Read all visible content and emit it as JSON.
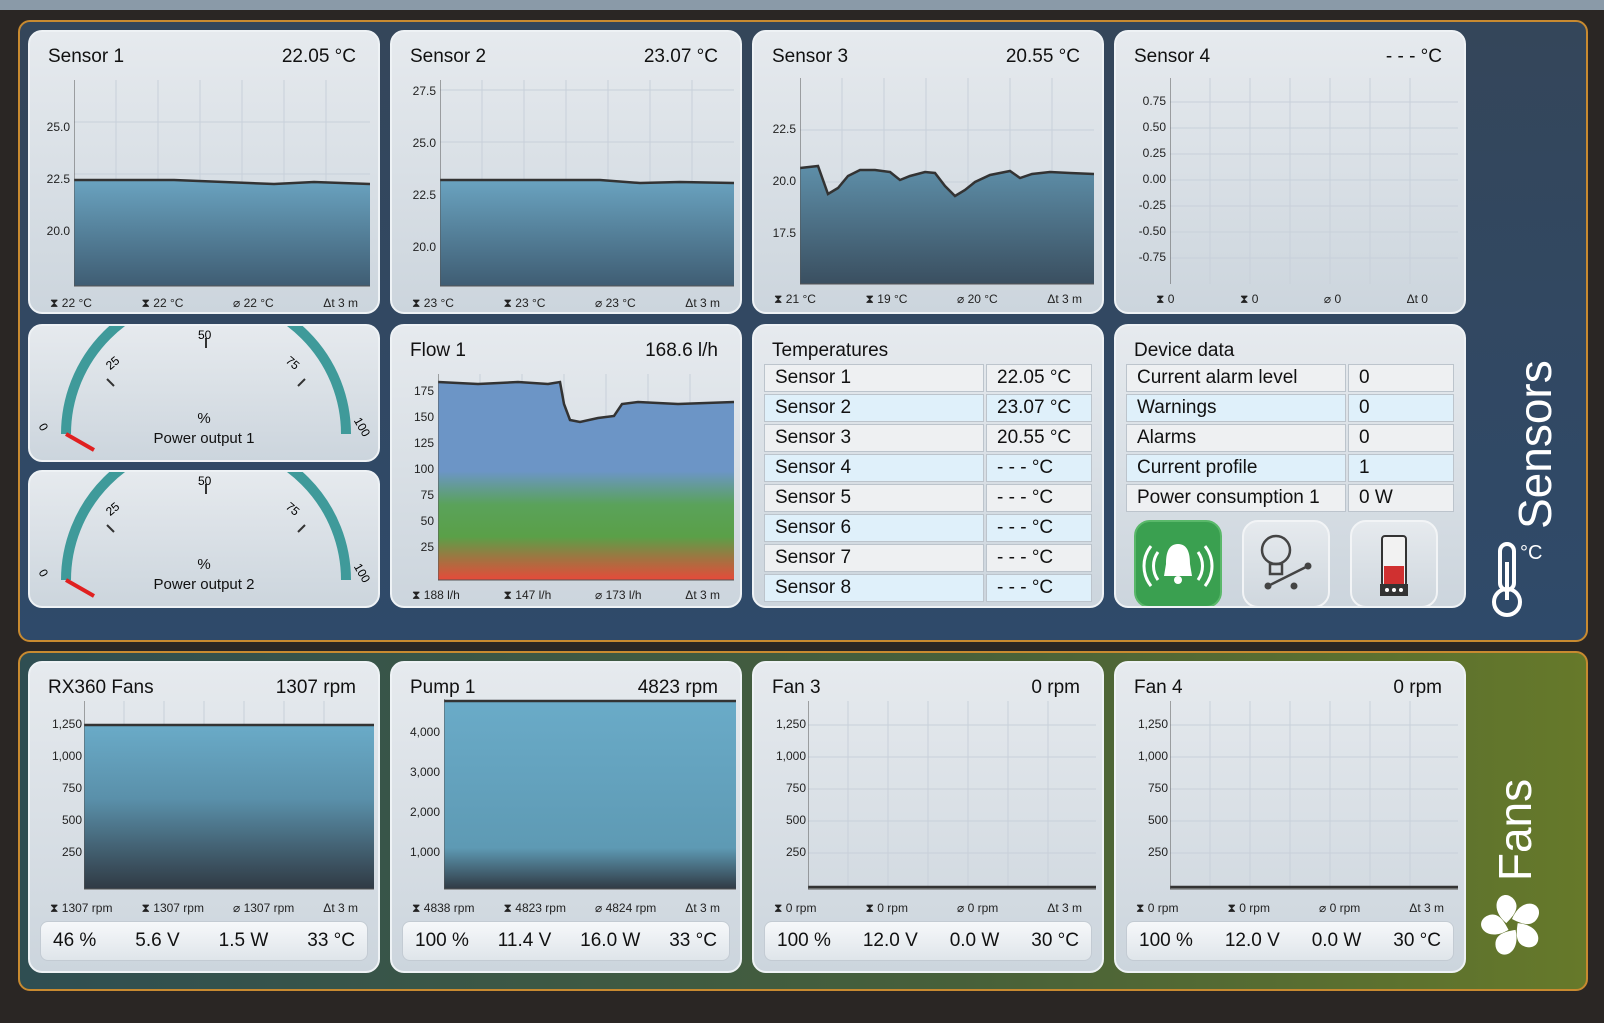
{
  "groups": {
    "sensors_label": "Sensors",
    "fans_label": "Fans"
  },
  "colors": {
    "group_border": "#c88a30",
    "fill_top": "#6aa3c0",
    "fill_bottom": "#3d5a70",
    "gauge_arc": "#3f9a9a",
    "needle": "#e02020",
    "alarm_button": "#3aa050"
  },
  "sensor_charts": [
    {
      "title": "Sensor 1",
      "value": "22.05 °C",
      "ticks": [
        "25.0",
        "22.5",
        "20.0"
      ],
      "stats": [
        "22 °C",
        "22 °C",
        "22 °C",
        "3 m"
      ]
    },
    {
      "title": "Sensor 2",
      "value": "23.07 °C",
      "ticks": [
        "27.5",
        "25.0",
        "22.5",
        "20.0"
      ],
      "stats": [
        "23 °C",
        "23 °C",
        "23 °C",
        "3 m"
      ]
    },
    {
      "title": "Sensor 3",
      "value": "20.55 °C",
      "ticks": [
        "22.5",
        "20.0",
        "17.5"
      ],
      "stats": [
        "21 °C",
        "19 °C",
        "20 °C",
        "3 m"
      ]
    },
    {
      "title": "Sensor 4",
      "value": "- - - °C",
      "ticks": [
        "0.75",
        "0.50",
        "0.25",
        "0.00",
        "-0.25",
        "-0.50",
        "-0.75"
      ],
      "stats": [
        "0",
        "0",
        "0",
        "0"
      ]
    }
  ],
  "gauges": [
    {
      "unit": "%",
      "title": "Power output 1",
      "value": 0,
      "ticks": [
        "0",
        "25",
        "50",
        "75",
        "100"
      ]
    },
    {
      "unit": "%",
      "title": "Power output 2",
      "value": 0,
      "ticks": [
        "0",
        "25",
        "50",
        "75",
        "100"
      ]
    }
  ],
  "flow": {
    "title": "Flow 1",
    "value": "168.6 l/h",
    "ticks": [
      "175",
      "150",
      "125",
      "100",
      "75",
      "50",
      "25"
    ],
    "stats": [
      "188 l/h",
      "147 l/h",
      "173 l/h",
      "3 m"
    ]
  },
  "temperatures": {
    "title": "Temperatures",
    "rows": [
      {
        "name": "Sensor 1",
        "value": "22.05 °C"
      },
      {
        "name": "Sensor 2",
        "value": "23.07 °C"
      },
      {
        "name": "Sensor 3",
        "value": "20.55 °C"
      },
      {
        "name": "Sensor 4",
        "value": "- - - °C"
      },
      {
        "name": "Sensor 5",
        "value": "- - - °C"
      },
      {
        "name": "Sensor 6",
        "value": "- - - °C"
      },
      {
        "name": "Sensor 7",
        "value": "- - - °C"
      },
      {
        "name": "Sensor 8",
        "value": "- - - °C"
      }
    ]
  },
  "device": {
    "title": "Device data",
    "rows": [
      {
        "name": "Current alarm level",
        "value": "0"
      },
      {
        "name": "Warnings",
        "value": "0"
      },
      {
        "name": "Alarms",
        "value": "0"
      },
      {
        "name": "Current profile",
        "value": "1"
      },
      {
        "name": "Power consumption 1",
        "value": "0 W"
      }
    ]
  },
  "fan_charts": [
    {
      "title": "RX360 Fans",
      "value": "1307 rpm",
      "ticks": [
        "1,250",
        "1,000",
        "750",
        "500",
        "250"
      ],
      "stats": [
        "1307 rpm",
        "1307 rpm",
        "1307 rpm",
        "3 m"
      ],
      "footer": [
        "46 %",
        "5.6 V",
        "1.5 W",
        "33 °C"
      ]
    },
    {
      "title": "Pump 1",
      "value": "4823 rpm",
      "ticks": [
        "4,000",
        "3,000",
        "2,000",
        "1,000"
      ],
      "stats": [
        "4838 rpm",
        "4823 rpm",
        "4824 rpm",
        "3 m"
      ],
      "footer": [
        "100 %",
        "11.4 V",
        "16.0 W",
        "33 °C"
      ]
    },
    {
      "title": "Fan 3",
      "value": "0 rpm",
      "ticks": [
        "1,250",
        "1,000",
        "750",
        "500",
        "250"
      ],
      "stats": [
        "0 rpm",
        "0 rpm",
        "0 rpm",
        "3 m"
      ],
      "footer": [
        "100 %",
        "12.0 V",
        "0.0 W",
        "30 °C"
      ]
    },
    {
      "title": "Fan 4",
      "value": "0 rpm",
      "ticks": [
        "1,250",
        "1,000",
        "750",
        "500",
        "250"
      ],
      "stats": [
        "0 rpm",
        "0 rpm",
        "0 rpm",
        "3 m"
      ],
      "footer": [
        "100 %",
        "12.0 V",
        "0.0 W",
        "30 °C"
      ]
    }
  ],
  "icons": {
    "thermometer_unit": "°C"
  }
}
